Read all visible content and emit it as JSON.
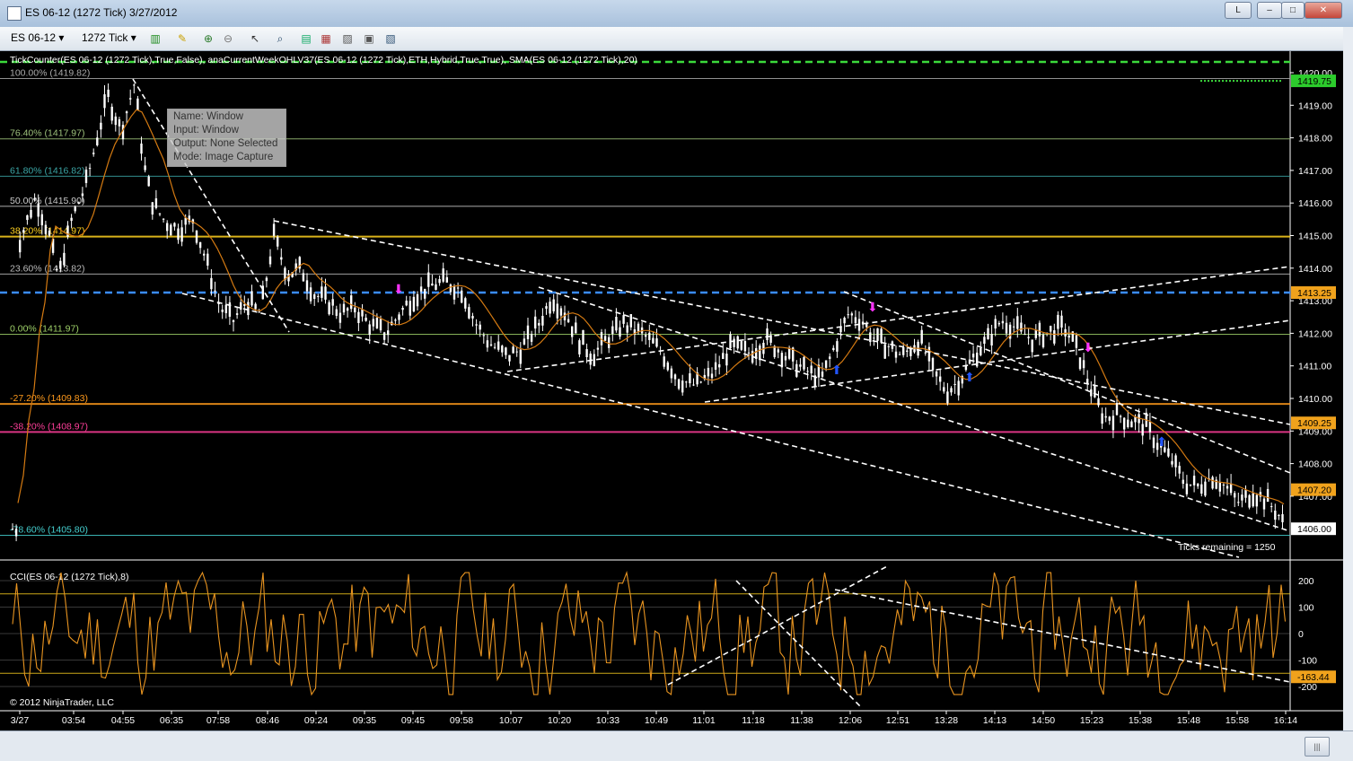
{
  "window": {
    "title": "ES 06-12 (1272 Tick)  3/27/2012",
    "buttons": {
      "link": "L",
      "minimize": "–",
      "maximize": "□",
      "close": "✕"
    }
  },
  "toolbar": {
    "instrument": "ES 06-12",
    "interval": "1272 Tick",
    "icons": [
      "bar-type-icon",
      "drawing-pencil-icon",
      "zoom-in-icon",
      "zoom-out-icon",
      "cursor-icon",
      "magnifier-icon",
      "indicators-icon",
      "strategies-icon",
      "chart-properties-icon",
      "data-box-icon",
      "chart-template-icon"
    ]
  },
  "price_panel": {
    "header": "TickCounter(ES 06-12 (1272 Tick),True,False), anaCurrentWeekOHLV37(ES 06-12 (1272 Tick),ETH,Hybrid,True,True), SMA(ES 06-12 (1272 Tick),20)",
    "fib_levels": [
      {
        "label": "100.00% (1419.82)",
        "price": 1419.82,
        "color": "#aaaaaa"
      },
      {
        "label": "76.40% (1417.97)",
        "price": 1417.97,
        "color": "#9ec27c"
      },
      {
        "label": "61.80% (1416.82)",
        "price": 1416.82,
        "color": "#3ca7a7"
      },
      {
        "label": "50.00% (1415.90)",
        "price": 1415.9,
        "color": "#cccccc"
      },
      {
        "label": "38.20% (1414.97)",
        "price": 1414.97,
        "color": "#ffd21f"
      },
      {
        "label": "23.60% (1413.82)",
        "price": 1413.82,
        "color": "#bbbbbb"
      },
      {
        "label": "0.00% (1411.97)",
        "price": 1411.97,
        "color": "#9ed068"
      },
      {
        "label": "-27.20% (1409.83)",
        "price": 1409.83,
        "color": "#ff9a1c"
      },
      {
        "label": "-38.20% (1408.97)",
        "price": 1408.97,
        "color": "#ff3f9a"
      },
      {
        "label": "-78.60% (1405.80)",
        "price": 1405.8,
        "color": "#45d0d0"
      }
    ],
    "axis_ticks": [
      "1420.00",
      "1419.00",
      "1418.00",
      "1417.00",
      "1416.00",
      "1415.00",
      "1414.00",
      "1413.00",
      "1412.00",
      "1411.00",
      "1410.00",
      "1409.00",
      "1408.00",
      "1407.00"
    ],
    "price_badges": [
      {
        "text": "1419.75",
        "price": 1419.75,
        "bg": "#2ccc2c",
        "fg": "#000000"
      },
      {
        "text": "1413.25",
        "price": 1413.25,
        "bg": "#f0a21c",
        "fg": "#000000"
      },
      {
        "text": "1409.25",
        "price": 1409.25,
        "bg": "#f0a21c",
        "fg": "#000000"
      },
      {
        "text": "1407.20",
        "price": 1407.2,
        "bg": "#f0a21c",
        "fg": "#000000"
      },
      {
        "text": "1406.00",
        "price": 1406.0,
        "bg": "#ffffff",
        "fg": "#000000"
      }
    ],
    "ticks_remaining": "Ticks remaining = 1250",
    "colors": {
      "dashed_blue": "#3a8cff",
      "dashed_green": "#3bd93b",
      "sma": "#d47a12",
      "bars": "#ffffff",
      "trend": "#ffffff"
    }
  },
  "tooltip": {
    "name": "Name: Window",
    "input": "Input: Window",
    "output": "Output: None Selected",
    "mode": "Mode: Image Capture"
  },
  "cci_panel": {
    "header": "CCI(ES 06-12 (1272 Tick),8)",
    "axis_ticks": [
      "200",
      "100",
      "0",
      "-100",
      "-200"
    ],
    "current_badge": {
      "text": "-163.44",
      "bg": "#f0a21c"
    },
    "line_color": "#e89420",
    "copyright": "© 2012 NinjaTrader, LLC"
  },
  "time_axis": [
    "3/27",
    "03:54",
    "04:55",
    "06:35",
    "07:58",
    "08:46",
    "09:24",
    "09:35",
    "09:45",
    "09:58",
    "10:07",
    "10:20",
    "10:33",
    "10:49",
    "11:01",
    "11:18",
    "11:38",
    "12:06",
    "12:51",
    "13:28",
    "14:13",
    "14:50",
    "15:23",
    "15:38",
    "15:48",
    "15:58",
    "16:14"
  ]
}
